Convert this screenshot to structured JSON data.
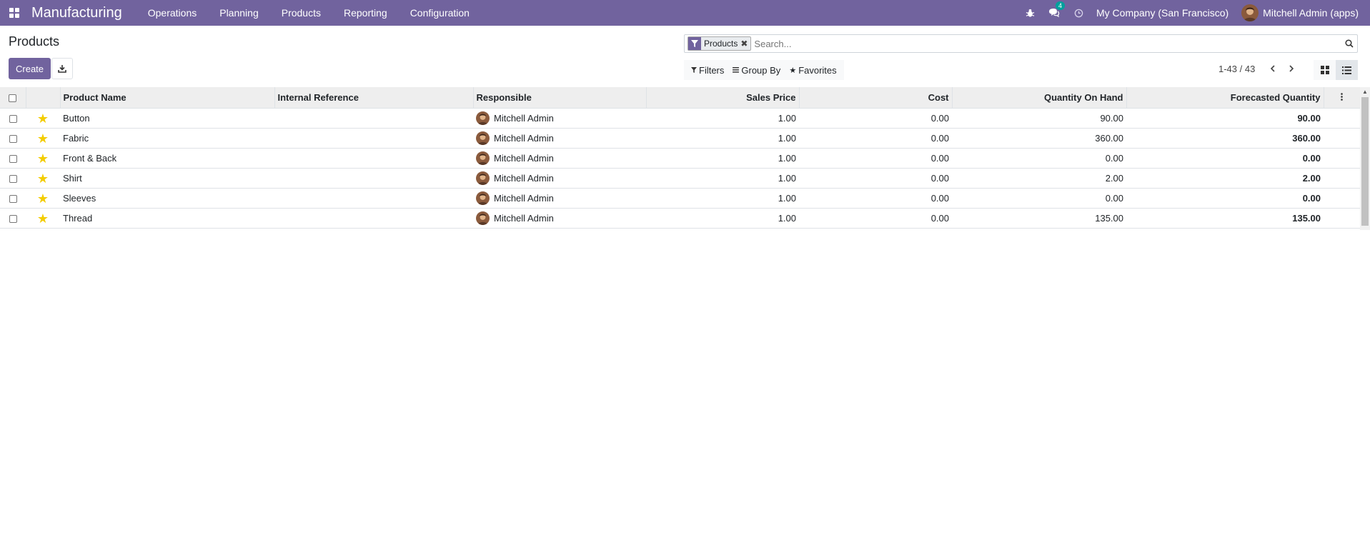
{
  "navbar": {
    "brand": "Manufacturing",
    "menu": [
      "Operations",
      "Planning",
      "Products",
      "Reporting",
      "Configuration"
    ],
    "messages_badge": "4",
    "company": "My Company (San Francisco)",
    "user": "Mitchell Admin (apps)",
    "colors": {
      "navbar_bg": "#71639e"
    }
  },
  "control": {
    "title": "Products",
    "create_label": "Create",
    "search": {
      "facet_label": "Products",
      "placeholder": "Search..."
    },
    "options": {
      "filters": "Filters",
      "group_by": "Group By",
      "favorites": "Favorites"
    },
    "pager": "1-43 / 43"
  },
  "table": {
    "columns": [
      "Product Name",
      "Internal Reference",
      "Responsible",
      "Sales Price",
      "Cost",
      "Quantity On Hand",
      "Forecasted Quantity"
    ],
    "rows": [
      {
        "name": "Button",
        "ref": "",
        "responsible": "Mitchell Admin",
        "price": "1.00",
        "cost": "0.00",
        "on_hand": "90.00",
        "forecast": "90.00"
      },
      {
        "name": "Fabric",
        "ref": "",
        "responsible": "Mitchell Admin",
        "price": "1.00",
        "cost": "0.00",
        "on_hand": "360.00",
        "forecast": "360.00"
      },
      {
        "name": "Front & Back",
        "ref": "",
        "responsible": "Mitchell Admin",
        "price": "1.00",
        "cost": "0.00",
        "on_hand": "0.00",
        "forecast": "0.00"
      },
      {
        "name": "Shirt",
        "ref": "",
        "responsible": "Mitchell Admin",
        "price": "1.00",
        "cost": "0.00",
        "on_hand": "2.00",
        "forecast": "2.00"
      },
      {
        "name": "Sleeves",
        "ref": "",
        "responsible": "Mitchell Admin",
        "price": "1.00",
        "cost": "0.00",
        "on_hand": "0.00",
        "forecast": "0.00"
      },
      {
        "name": "Thread",
        "ref": "",
        "responsible": "Mitchell Admin",
        "price": "1.00",
        "cost": "0.00",
        "on_hand": "135.00",
        "forecast": "135.00"
      }
    ]
  }
}
